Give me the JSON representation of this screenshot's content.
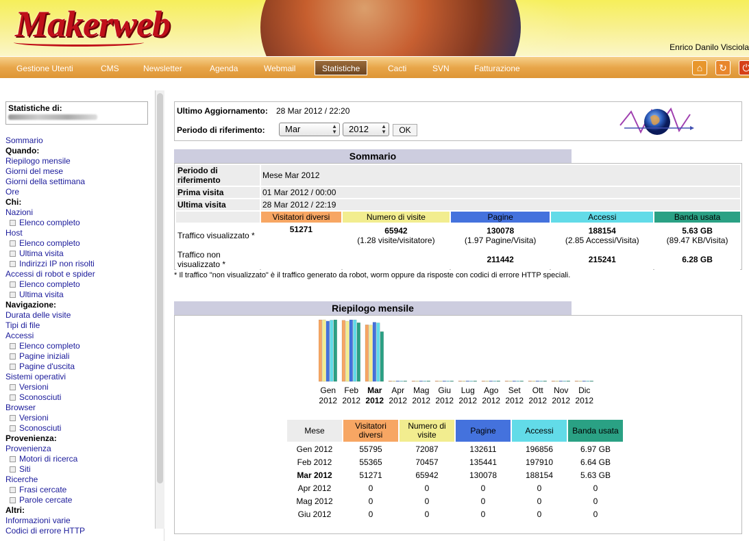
{
  "header": {
    "logo": "Makerweb",
    "user_name": "Enrico Danilo Visciola"
  },
  "nav": {
    "items": [
      "Gestione Utenti",
      "CMS",
      "Newsletter",
      "Agenda",
      "Webmail",
      "Statistiche",
      "Cacti",
      "SVN",
      "Fatturazione"
    ],
    "active": "Statistiche",
    "icons": [
      "home-icon",
      "refresh-icon",
      "power-icon"
    ]
  },
  "sidebar": {
    "stats_label": "Statistiche di:",
    "entries": [
      {
        "t": "link",
        "l": "Sommario"
      },
      {
        "t": "head",
        "l": "Quando:"
      },
      {
        "t": "link",
        "l": "Riepilogo mensile"
      },
      {
        "t": "link",
        "l": "Giorni del mese"
      },
      {
        "t": "link",
        "l": "Giorni della settimana"
      },
      {
        "t": "link",
        "l": "Ore"
      },
      {
        "t": "head",
        "l": "Chi:"
      },
      {
        "t": "link",
        "l": "Nazioni"
      },
      {
        "t": "sub",
        "l": "Elenco completo"
      },
      {
        "t": "link",
        "l": "Host"
      },
      {
        "t": "sub",
        "l": "Elenco completo"
      },
      {
        "t": "sub",
        "l": "Ultima visita"
      },
      {
        "t": "sub",
        "l": "Indirizzi IP non risolti"
      },
      {
        "t": "link",
        "l": "Accessi di robot e spider"
      },
      {
        "t": "sub",
        "l": "Elenco completo"
      },
      {
        "t": "sub",
        "l": "Ultima visita"
      },
      {
        "t": "head",
        "l": "Navigazione:"
      },
      {
        "t": "link",
        "l": "Durata delle visite"
      },
      {
        "t": "link",
        "l": "Tipi di file"
      },
      {
        "t": "link",
        "l": "Accessi"
      },
      {
        "t": "sub",
        "l": "Elenco completo"
      },
      {
        "t": "sub",
        "l": "Pagine iniziali"
      },
      {
        "t": "sub",
        "l": "Pagine d'uscita"
      },
      {
        "t": "link",
        "l": "Sistemi operativi"
      },
      {
        "t": "sub",
        "l": "Versioni"
      },
      {
        "t": "sub",
        "l": "Sconosciuti"
      },
      {
        "t": "link",
        "l": "Browser"
      },
      {
        "t": "sub",
        "l": "Versioni"
      },
      {
        "t": "sub",
        "l": "Sconosciuti"
      },
      {
        "t": "head",
        "l": "Provenienza:"
      },
      {
        "t": "link",
        "l": "Provenienza"
      },
      {
        "t": "sub",
        "l": "Motori di ricerca"
      },
      {
        "t": "sub",
        "l": "Siti"
      },
      {
        "t": "link",
        "l": "Ricerche"
      },
      {
        "t": "sub",
        "l": "Frasi cercate"
      },
      {
        "t": "sub",
        "l": "Parole cercate"
      },
      {
        "t": "head",
        "l": "Altri:"
      },
      {
        "t": "link",
        "l": "Informazioni varie"
      },
      {
        "t": "link",
        "l": "Codici di errore HTTP"
      }
    ]
  },
  "update": {
    "label": "Ultimo Aggiornamento:",
    "value": "28 Mar 2012 / 22:20",
    "period_label": "Periodo di riferimento:",
    "month": "Mar",
    "year": "2012",
    "ok": "OK"
  },
  "summary": {
    "title": "Sommario",
    "period_label": "Periodo di riferimento",
    "period_value": "Mese Mar 2012",
    "first_label": "Prima visita",
    "first_value": "01 Mar 2012 / 00:00",
    "last_label": "Ultima visita",
    "last_value": "28 Mar 2012 / 22:19",
    "headers": [
      "Visitatori diversi",
      "Numero di visite",
      "Pagine",
      "Accessi",
      "Banda usata"
    ],
    "viewed_label": "Traffico visualizzato *",
    "viewed": {
      "visitors": "51271",
      "visits": "65942",
      "visits_sub": "(1.28 visite/visitatore)",
      "pages": "130078",
      "pages_sub": "(1.97 Pagine/Visita)",
      "hits": "188154",
      "hits_sub": "(2.85 Accessi/Visita)",
      "bw": "5.63 GB",
      "bw_sub": "(89.47 KB/Visita)"
    },
    "notviewed_label": "Traffico non visualizzato *",
    "notviewed": {
      "pages": "211442",
      "hits": "215241",
      "bw": "6.28 GB"
    },
    "note": "* Il traffico \"non visualizzato\" è il traffico generato da robot, worm oppure da risposte con codici di errore HTTP speciali."
  },
  "monthly": {
    "title": "Riepilogo mensile",
    "headers": [
      "Mese",
      "Visitatori diversi",
      "Numero di visite",
      "Pagine",
      "Accessi",
      "Banda usata"
    ],
    "rows": [
      {
        "m": "Gen 2012",
        "v": "55795",
        "n": "72087",
        "p": "132611",
        "a": "196856",
        "b": "6.97 GB"
      },
      {
        "m": "Feb 2012",
        "v": "55365",
        "n": "70457",
        "p": "135441",
        "a": "197910",
        "b": "6.64 GB"
      },
      {
        "m": "Mar 2012",
        "v": "51271",
        "n": "65942",
        "p": "130078",
        "a": "188154",
        "b": "5.63 GB",
        "bold": true
      },
      {
        "m": "Apr 2012",
        "v": "0",
        "n": "0",
        "p": "0",
        "a": "0",
        "b": "0"
      },
      {
        "m": "Mag 2012",
        "v": "0",
        "n": "0",
        "p": "0",
        "a": "0",
        "b": "0"
      },
      {
        "m": "Giu 2012",
        "v": "0",
        "n": "0",
        "p": "0",
        "a": "0",
        "b": "0"
      }
    ]
  },
  "colors": {
    "visitors": "#f7a663",
    "visits": "#f2ed8f",
    "pages": "#4472dd",
    "hits": "#62dbe8",
    "bandwidth": "#2aa184"
  },
  "chart_data": {
    "type": "bar",
    "categories": [
      "Gen",
      "Feb",
      "Mar",
      "Apr",
      "Mag",
      "Giu",
      "Lug",
      "Ago",
      "Set",
      "Ott",
      "Nov",
      "Dic"
    ],
    "year_label": "2012",
    "current_index": 2,
    "series": [
      {
        "key": "visitors",
        "values": [
          55795,
          55365,
          51271,
          0,
          0,
          0,
          0,
          0,
          0,
          0,
          0,
          0
        ]
      },
      {
        "key": "visits",
        "values": [
          72087,
          70457,
          65942,
          0,
          0,
          0,
          0,
          0,
          0,
          0,
          0,
          0
        ]
      },
      {
        "key": "pages",
        "values": [
          132611,
          135441,
          130078,
          0,
          0,
          0,
          0,
          0,
          0,
          0,
          0,
          0
        ]
      },
      {
        "key": "hits",
        "values": [
          196856,
          197910,
          188154,
          0,
          0,
          0,
          0,
          0,
          0,
          0,
          0,
          0
        ]
      },
      {
        "key": "bandwidth",
        "values": [
          6.97,
          6.64,
          5.63,
          0,
          0,
          0,
          0,
          0,
          0,
          0,
          0,
          0
        ]
      }
    ]
  }
}
